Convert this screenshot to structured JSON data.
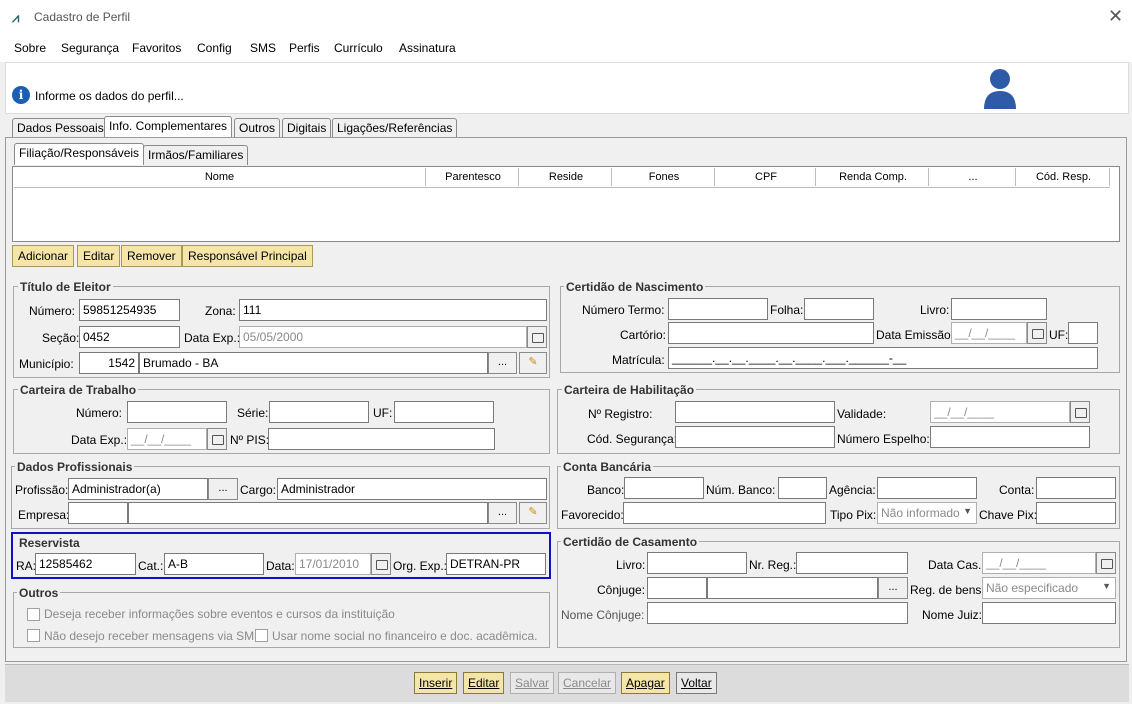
{
  "window": {
    "title": "Cadastro de Perfil"
  },
  "menu": [
    "Sobre",
    "Segurança",
    "Favoritos",
    "Config",
    "SMS",
    "Perfis",
    "Currículo",
    "Assinatura"
  ],
  "info": {
    "text": "Informe os dados do perfil..."
  },
  "tabs": [
    "Dados Pessoais",
    "Info. Complementares",
    "Outros",
    "Digitais",
    "Ligações/Referências"
  ],
  "subtabs": [
    "Filiação/Responsáveis",
    "Irmãos/Familiares"
  ],
  "grid": {
    "columns": [
      "Nome",
      "Parentesco",
      "Reside",
      "Fones",
      "CPF",
      "Renda Comp.",
      "...",
      "Cód. Resp."
    ]
  },
  "grid_buttons": [
    "Adicionar",
    "Editar",
    "Remover",
    "Responsável Principal"
  ],
  "titulo_eleitor": {
    "title": "Título de Eleitor",
    "numero_label": "Número:",
    "numero": "59851254935",
    "zona_label": "Zona:",
    "zona": "111",
    "secao_label": "Seção:",
    "secao": "0452",
    "data_exp_label": "Data Exp.:",
    "data_exp": "05/05/2000",
    "municipio_label": "Município:",
    "municipio_codigo": "1542",
    "municipio_nome": "Brumado - BA"
  },
  "certidao_nascimento": {
    "title": "Certidão de Nascimento",
    "numero_termo_label": "Número Termo:",
    "folha_label": "Folha:",
    "livro_label": "Livro:",
    "cartorio_label": "Cartório:",
    "data_emissao_label": "Data Emissão:",
    "data_emissao": "__/__/____",
    "uf_label": "UF:",
    "matricula_label": "Matrícula:",
    "matricula": "______.__.__.____.__.____.___.______-__"
  },
  "carteira_trabalho": {
    "title": "Carteira de Trabalho",
    "numero_label": "Número:",
    "serie_label": "Série:",
    "uf_label": "UF:",
    "data_exp_label": "Data Exp.:",
    "data_exp": "__/__/____",
    "pis_label": "Nº PIS:"
  },
  "carteira_habilitacao": {
    "title": "Carteira de Habilitação",
    "registro_label": "Nº Registro:",
    "validade_label": "Validade:",
    "validade": "__/__/____",
    "seguranca_label": "Cód. Segurança:",
    "espelho_label": "Número Espelho:"
  },
  "dados_profissionais": {
    "title": "Dados Profissionais",
    "profissao_label": "Profissão:",
    "profissao": "Administrador(a)",
    "cargo_label": "Cargo:",
    "cargo": "Administrador",
    "empresa_label": "Empresa:"
  },
  "conta_bancaria": {
    "title": "Conta Bancária",
    "banco_label": "Banco:",
    "num_banco_label": "Núm. Banco:",
    "agencia_label": "Agência:",
    "conta_label": "Conta:",
    "favorecido_label": "Favorecido:",
    "tipo_pix_label": "Tipo Pix:",
    "tipo_pix": "Não informado",
    "chave_pix_label": "Chave Pix:"
  },
  "reservista": {
    "title": "Reservista",
    "ra_label": "RA:",
    "ra": "12585462",
    "cat_label": "Cat.:",
    "cat": "A-B",
    "data_label": "Data:",
    "data": "17/01/2010",
    "org_label": "Org. Exp.:",
    "org": "DETRAN-PR",
    "highlight_color": "#1010c8"
  },
  "certidao_casamento": {
    "title": "Certidão de Casamento",
    "livro_label": "Livro:",
    "nr_reg_label": "Nr. Reg.:",
    "data_cas_label": "Data Cas.:",
    "data_cas": "__/__/____",
    "conjuge_label": "Cônjuge:",
    "reg_bens_label": "Reg. de bens:",
    "reg_bens": "Não especificado",
    "nome_conjuge_label": "Nome Cônjuge:",
    "nome_juiz_label": "Nome Juiz:"
  },
  "outros": {
    "title": "Outros",
    "opt1": "Deseja receber informações sobre eventos e cursos da instituição",
    "opt2": "Não desejo receber mensagens via SMS",
    "opt3": "Usar nome social no financeiro e doc. acadêmica."
  },
  "bottom_buttons": [
    "Inserir",
    "Editar",
    "Salvar",
    "Cancelar",
    "Apagar",
    "Voltar"
  ],
  "colors": {
    "accent_yellow": "#f5e6a8",
    "highlight_blue": "#1010c8",
    "avatar_blue": "#2f5aa8"
  }
}
